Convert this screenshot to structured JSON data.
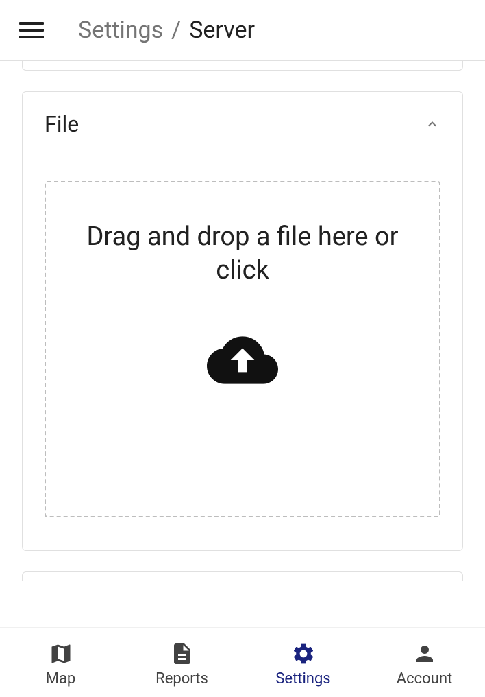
{
  "breadcrumb": {
    "parent": "Settings",
    "separator": "/",
    "current": "Server"
  },
  "fileCard": {
    "title": "File",
    "dropzoneText": "Drag and drop a file here or click"
  },
  "bottomNav": {
    "items": [
      {
        "label": "Map"
      },
      {
        "label": "Reports"
      },
      {
        "label": "Settings"
      },
      {
        "label": "Account"
      }
    ]
  }
}
